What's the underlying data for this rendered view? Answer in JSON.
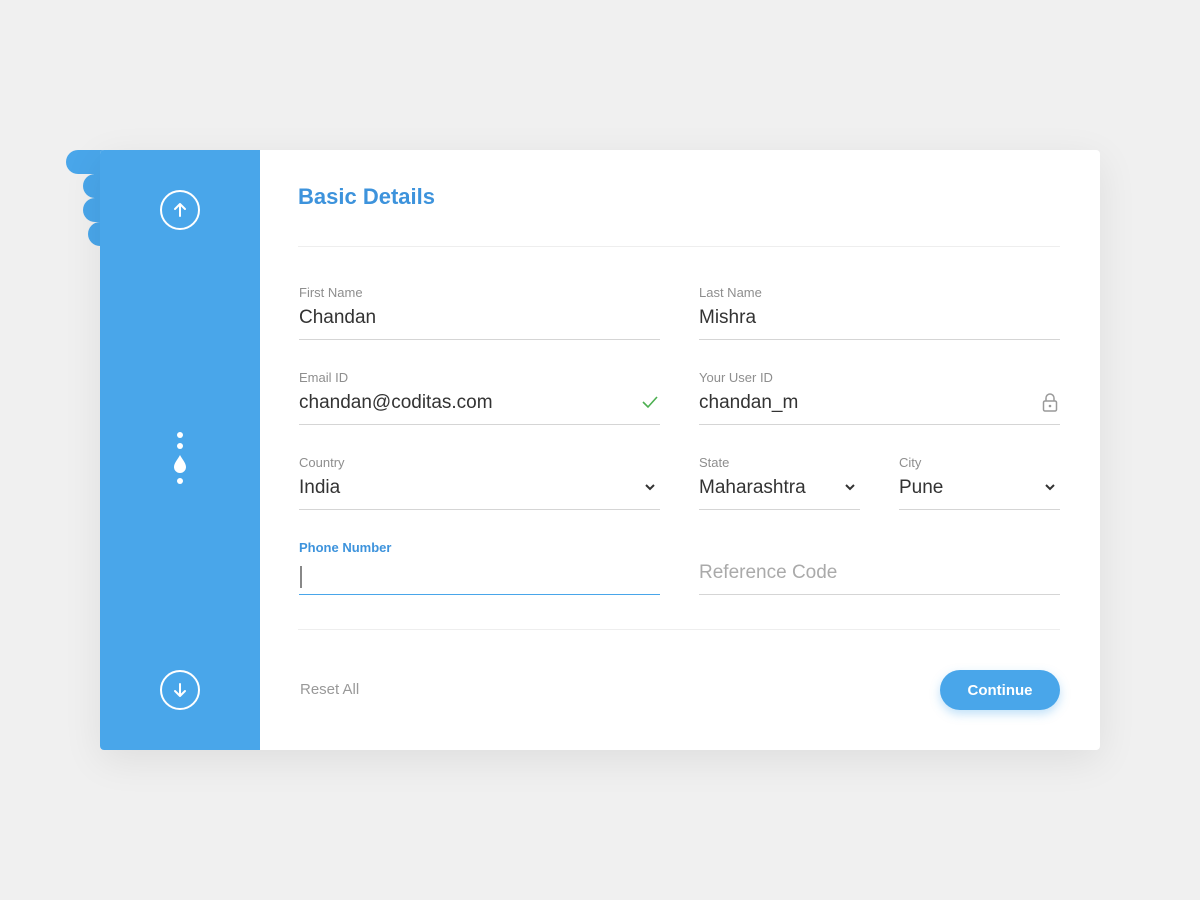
{
  "form": {
    "title": "Basic Details",
    "fields": {
      "first_name": {
        "label": "First Name",
        "value": "Chandan"
      },
      "last_name": {
        "label": "Last Name",
        "value": "Mishra"
      },
      "email": {
        "label": "Email ID",
        "value": "chandan@coditas.com",
        "status": "valid"
      },
      "user_id": {
        "label": "Your User ID",
        "value": "chandan_m",
        "status": "locked"
      },
      "country": {
        "label": "Country",
        "value": "India"
      },
      "state": {
        "label": "State",
        "value": "Maharashtra"
      },
      "city": {
        "label": "City",
        "value": "Pune"
      },
      "phone": {
        "label": "Phone Number",
        "value": ""
      },
      "reference": {
        "placeholder": "Reference Code",
        "value": ""
      }
    },
    "actions": {
      "reset_label": "Reset All",
      "continue_label": "Continue"
    }
  },
  "sidebar": {
    "up_icon": "arrow-up-icon",
    "down_icon": "arrow-down-icon",
    "progress_icon": "drop-progress-icon"
  },
  "colors": {
    "accent": "#49a6ea",
    "title": "#3d93dc",
    "valid": "#4caf50"
  }
}
